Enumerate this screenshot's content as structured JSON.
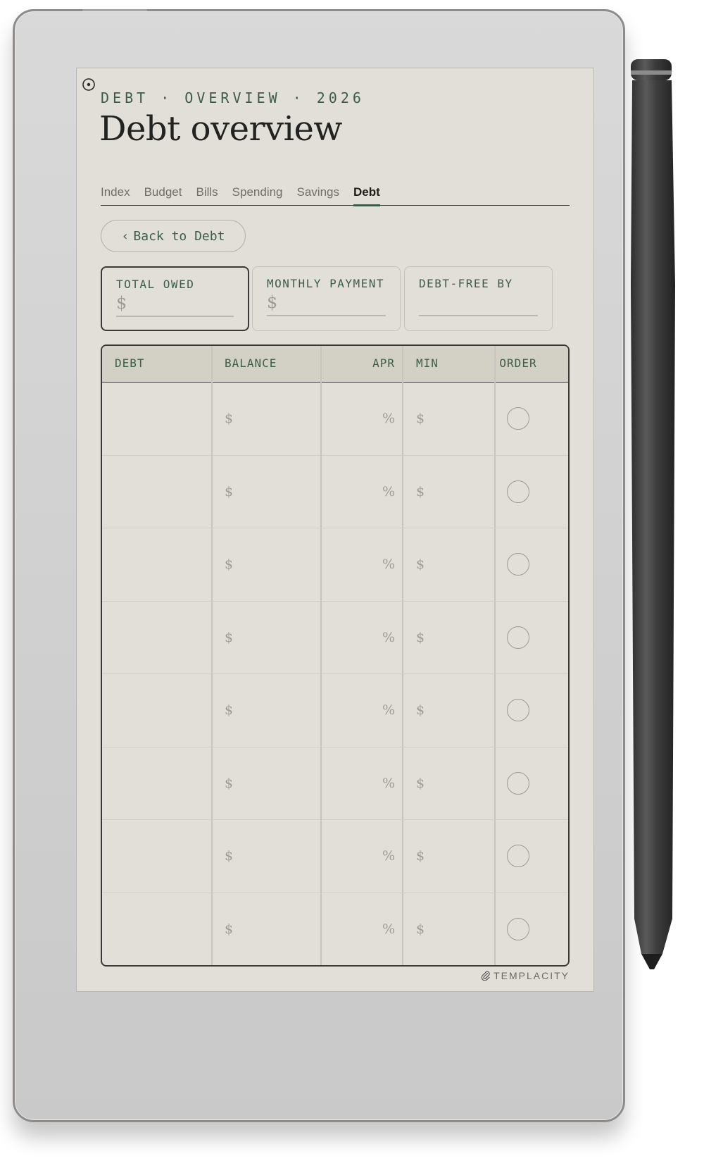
{
  "header": {
    "eyebrow": "DEBT · OVERVIEW · 2026",
    "title": "Debt overview"
  },
  "tabs": [
    {
      "label": "Index",
      "active": false
    },
    {
      "label": "Budget",
      "active": false
    },
    {
      "label": "Bills",
      "active": false
    },
    {
      "label": "Spending",
      "active": false
    },
    {
      "label": "Savings",
      "active": false
    },
    {
      "label": "Debt",
      "active": true
    }
  ],
  "back_button": {
    "label": "Back to Debt",
    "icon": "chevron-left-icon"
  },
  "summary": [
    {
      "label": "TOTAL OWED",
      "value": "$"
    },
    {
      "label": "MONTHLY PAYMENT",
      "value": "$"
    },
    {
      "label": "DEBT-FREE BY",
      "value": ""
    }
  ],
  "table": {
    "columns": [
      "DEBT",
      "BALANCE",
      "APR",
      "MIN",
      "ORDER"
    ],
    "rows": [
      {
        "debt": "",
        "balance": "$",
        "apr": "%",
        "min": "$"
      },
      {
        "debt": "",
        "balance": "$",
        "apr": "%",
        "min": "$"
      },
      {
        "debt": "",
        "balance": "$",
        "apr": "%",
        "min": "$"
      },
      {
        "debt": "",
        "balance": "$",
        "apr": "%",
        "min": "$"
      },
      {
        "debt": "",
        "balance": "$",
        "apr": "%",
        "min": "$"
      },
      {
        "debt": "",
        "balance": "$",
        "apr": "%",
        "min": "$"
      },
      {
        "debt": "",
        "balance": "$",
        "apr": "%",
        "min": "$"
      },
      {
        "debt": "",
        "balance": "$",
        "apr": "%",
        "min": "$"
      }
    ]
  },
  "brand": {
    "name": "TEMPLACITY",
    "icon": "paperclip-icon"
  },
  "colors": {
    "accent": "#3c5e48",
    "paper": "#e1dfd8",
    "header_fill": "#d3d1c6",
    "ink": "#2a2a28"
  }
}
